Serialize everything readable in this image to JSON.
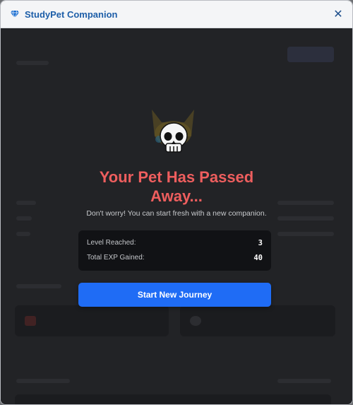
{
  "window": {
    "title": "StudyPet Companion",
    "close_label": "✕"
  },
  "modal": {
    "title_line1": "Your Pet Has Passed",
    "title_line2": "Away...",
    "subtitle": "Don't worry! You can start fresh with a new companion.",
    "stats": [
      {
        "label": "Level Reached:",
        "value": "3"
      },
      {
        "label": "Total EXP Gained:",
        "value": "40"
      }
    ],
    "button_label": "Start New Journey",
    "skull_glyph": "💀"
  },
  "colors": {
    "accent": "#1f6cf5",
    "title": "#ee5e5e",
    "titlebar_text": "#1d5ea8"
  },
  "icons": {
    "app": "diamond-icon",
    "close": "close-icon",
    "status": "skull-icon"
  }
}
